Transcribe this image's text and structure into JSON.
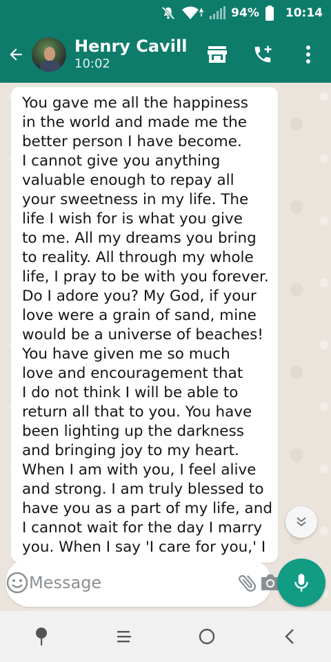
{
  "status_bar": {
    "battery_percent": "94%",
    "time": "10:14",
    "icons": [
      "notifications-off-icon",
      "wifi-icon",
      "signal-icon",
      "battery-icon"
    ]
  },
  "app_bar": {
    "contact_name": "Henry Cavill",
    "contact_status": "10:02",
    "actions": [
      "store-icon",
      "add-call-icon",
      "more-vert-icon"
    ]
  },
  "message": {
    "lines": [
      "You gave me all the happiness",
      "in the world and made me the",
      "better person I have become.",
      "I cannot give you anything",
      "valuable enough to repay all",
      "your sweetness in my life. The",
      "life I wish for is what you give",
      "to me. All my dreams you bring",
      "to reality. All through my whole",
      "life, I pray to be with you forever.",
      "Do I adore you? My God, if your",
      "love were a grain of sand, mine",
      "would be a universe of beaches!",
      "You have given me so much",
      "love and encouragement that",
      "I do not think I will be able to",
      "return all that to you. You have",
      "been lighting up the darkness",
      "and bringing joy to my heart.",
      "When I am with you, I feel alive",
      "and strong. I am truly blessed to",
      "have you as a part of my life, and",
      "I cannot wait for the day I marry",
      "you. When I say 'I care for you,' I"
    ]
  },
  "composer": {
    "placeholder": "Message"
  },
  "colors": {
    "header": "#0e7c6b",
    "mic_button": "#129c84",
    "chat_background": "#ebe4dc"
  }
}
